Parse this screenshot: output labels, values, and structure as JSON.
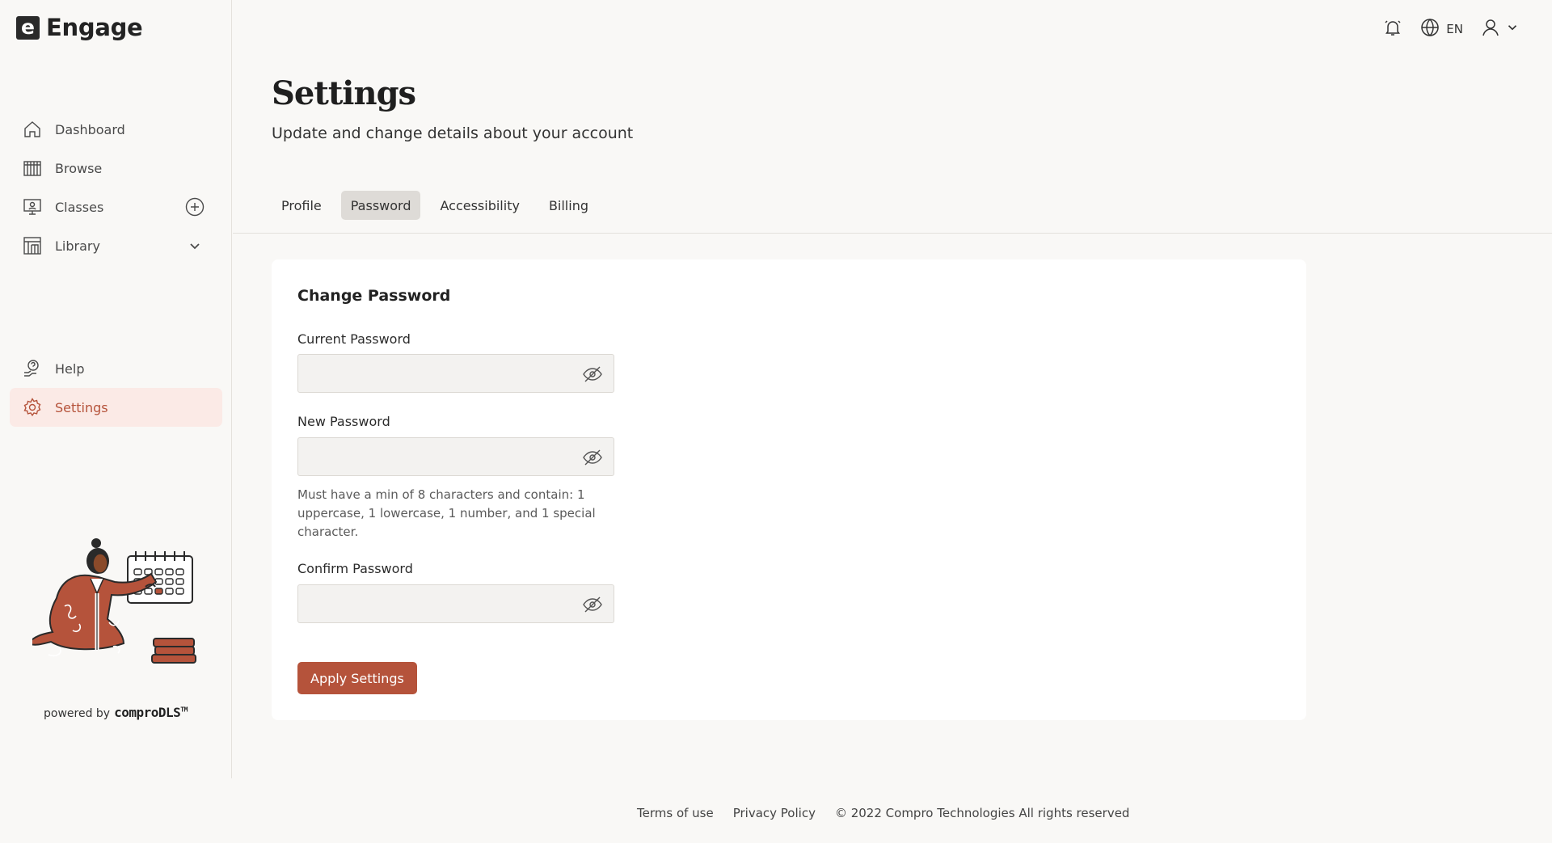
{
  "app": {
    "logo_letter": "e",
    "name": "Engage"
  },
  "sidebar": {
    "items": [
      {
        "label": "Dashboard",
        "icon": "home-icon"
      },
      {
        "label": "Browse",
        "icon": "books-icon"
      },
      {
        "label": "Classes",
        "icon": "classroom-icon",
        "trail_icon": "add-circle-icon"
      },
      {
        "label": "Library",
        "icon": "library-icon",
        "trail_icon": "chevron-down-icon"
      }
    ],
    "bottom_items": [
      {
        "label": "Help",
        "icon": "help-icon"
      },
      {
        "label": "Settings",
        "icon": "gear-icon",
        "active": true
      }
    ],
    "powered_by": {
      "prefix": "powered by",
      "brand": "comproDLS",
      "tm": "TM"
    }
  },
  "topbar": {
    "notification_icon": "bell-icon",
    "language_icon": "globe-icon",
    "language": "EN",
    "user_icon": "user-icon"
  },
  "header": {
    "title": "Settings",
    "subtitle": "Update and change details about your account"
  },
  "tabs": [
    {
      "label": "Profile"
    },
    {
      "label": "Password",
      "active": true
    },
    {
      "label": "Accessibility"
    },
    {
      "label": "Billing"
    }
  ],
  "form": {
    "title": "Change Password",
    "current_label": "Current Password",
    "current_value": "",
    "new_label": "New Password",
    "new_value": "",
    "hint": "Must have a min of 8 characters and contain: 1 uppercase, 1 lowercase, 1 number, and 1 special character.",
    "confirm_label": "Confirm Password",
    "confirm_value": "",
    "apply_label": "Apply Settings"
  },
  "footer": {
    "terms": "Terms of use",
    "privacy": "Privacy Policy",
    "copyright": "© 2022 Compro Technologies All rights reserved"
  },
  "colors": {
    "accent": "#b5533b",
    "active_bg": "#fbeae6",
    "background": "#f9f8f6",
    "card": "#ffffff"
  }
}
